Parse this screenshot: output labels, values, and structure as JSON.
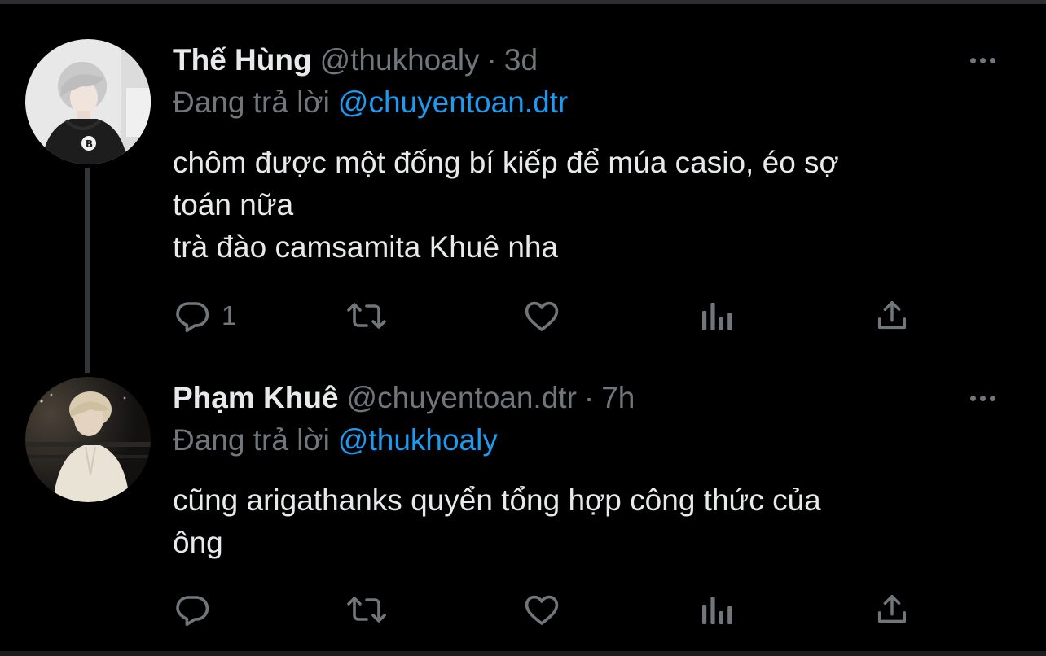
{
  "tweets": [
    {
      "display_name": "Thế Hùng",
      "handle": "@thukhoaly",
      "separator": "·",
      "time": "3d",
      "reply_prefix": "Đang trả lời",
      "reply_to": "@chuyentoan.dtr",
      "text_lines": [
        "chôm được một đống bí kiếp để múa casio, éo sợ",
        "toán nữa",
        "trà đào camsamita Khuê nha"
      ],
      "reply_count": "1",
      "avatar_icon": "user-avatar-hoodie"
    },
    {
      "display_name": "Phạm Khuê",
      "handle": "@chuyentoan.dtr",
      "separator": "·",
      "time": "7h",
      "reply_prefix": "Đang trả lời",
      "reply_to": "@thukhoaly",
      "text_lines": [
        "cũng arigathanks quyển tổng hợp công thức của",
        "ông"
      ],
      "reply_count": "",
      "avatar_icon": "user-avatar-night"
    }
  ],
  "icons": {
    "more": "more-horizontal-icon",
    "reply": "reply-icon",
    "retweet": "retweet-icon",
    "like": "heart-icon",
    "views": "views-chart-icon",
    "share": "share-icon"
  },
  "colors": {
    "background": "#000000",
    "text": "#e7e9ea",
    "muted": "#71767b",
    "accent": "#1d9bf0",
    "thread_line": "#333639"
  }
}
